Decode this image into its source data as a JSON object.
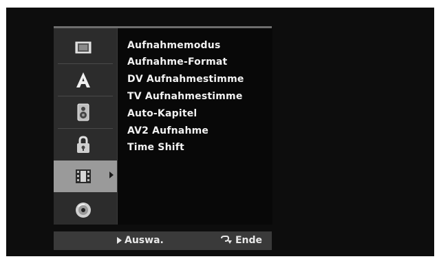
{
  "sidebar": {
    "items": [
      {
        "icon": "film-frame-icon"
      },
      {
        "icon": "letter-a-icon"
      },
      {
        "icon": "speaker-icon"
      },
      {
        "icon": "lock-icon"
      },
      {
        "icon": "film-reel-icon",
        "selected": true
      },
      {
        "icon": "disc-icon"
      }
    ]
  },
  "menu": {
    "items": [
      "Aufnahmemodus",
      "Aufnahme-Format",
      "DV Aufnahmestimme",
      "TV Aufnahmestimme",
      "Auto-Kapitel",
      "AV2 Aufnahme",
      "Time Shift"
    ]
  },
  "footer": {
    "select_label": "Auswa.",
    "end_label": "Ende"
  },
  "colors": {
    "background": "#0d0d0d",
    "sidebar": "#2c2c2c",
    "selected": "#9a9a9a",
    "text": "#f2f2f2",
    "footer": "#3a3a3a"
  }
}
